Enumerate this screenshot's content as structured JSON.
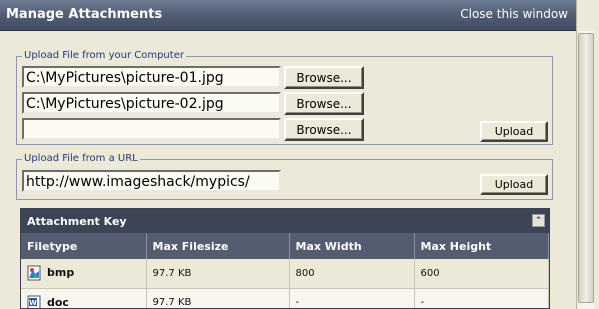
{
  "window": {
    "title": "Manage Attachments",
    "close_label": "Close this window"
  },
  "upload_computer": {
    "legend": "Upload File from your Computer",
    "files": [
      {
        "value": "C:\\MyPictures\\picture-01.jpg",
        "browse_label": "Browse..."
      },
      {
        "value": "C:\\MyPictures\\picture-02.jpg",
        "browse_label": "Browse..."
      },
      {
        "value": "",
        "browse_label": "Browse..."
      }
    ],
    "upload_label": "Upload"
  },
  "upload_url": {
    "legend": "Upload File from a URL",
    "value": "http://www.imageshack/mypics/",
    "upload_label": "Upload"
  },
  "attachment_key": {
    "title": "Attachment Key",
    "collapse_symbol": "⌃",
    "columns": [
      "Filetype",
      "Max Filesize",
      "Max Width",
      "Max Height"
    ],
    "rows": [
      {
        "filetype": "bmp",
        "icon": "bmp-file-icon",
        "size": "97.7 KB",
        "width": "800",
        "height": "600"
      },
      {
        "filetype": "doc",
        "icon": "doc-file-icon",
        "size": "97.7 KB",
        "width": "-",
        "height": "-"
      }
    ]
  }
}
